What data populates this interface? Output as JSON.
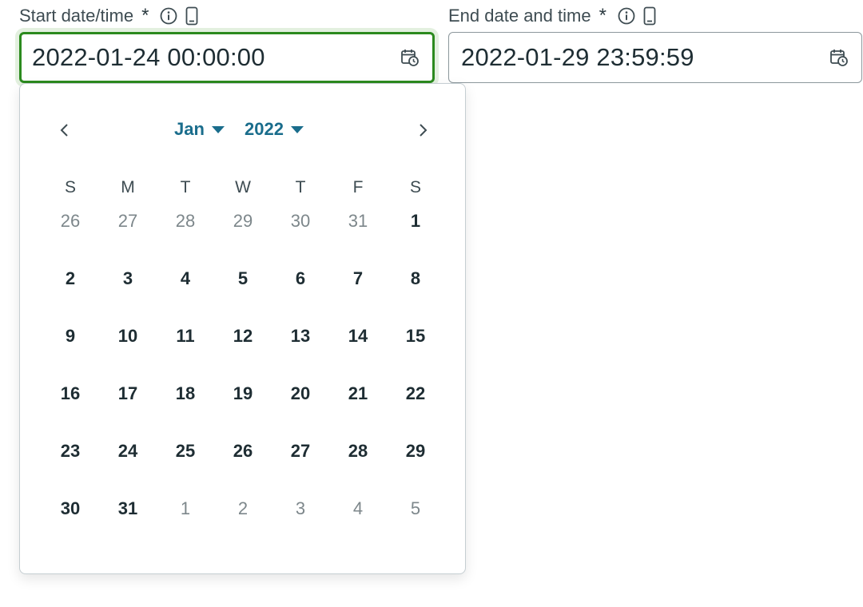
{
  "start_field": {
    "label": "Start date/time",
    "required_mark": "*",
    "value": "2022-01-24 00:00:00",
    "info_icon": "info-icon",
    "device_icon": "mobile-device-icon",
    "calendar_icon": "calendar-clock-icon"
  },
  "end_field": {
    "label": "End date and time",
    "required_mark": "*",
    "value": "2022-01-29 23:59:59",
    "info_icon": "info-icon",
    "device_icon": "mobile-device-icon",
    "calendar_icon": "calendar-clock-icon"
  },
  "calendar": {
    "month": "Jan",
    "year": "2022",
    "prev_icon": "chevron-left-icon",
    "next_icon": "chevron-right-icon",
    "weekdays": [
      "S",
      "M",
      "T",
      "W",
      "T",
      "F",
      "S"
    ],
    "weeks": [
      [
        {
          "d": "26",
          "out": true
        },
        {
          "d": "27",
          "out": true
        },
        {
          "d": "28",
          "out": true
        },
        {
          "d": "29",
          "out": true
        },
        {
          "d": "30",
          "out": true
        },
        {
          "d": "31",
          "out": true
        },
        {
          "d": "1",
          "out": false
        }
      ],
      [
        {
          "d": "2",
          "out": false
        },
        {
          "d": "3",
          "out": false
        },
        {
          "d": "4",
          "out": false
        },
        {
          "d": "5",
          "out": false
        },
        {
          "d": "6",
          "out": false
        },
        {
          "d": "7",
          "out": false
        },
        {
          "d": "8",
          "out": false
        }
      ],
      [
        {
          "d": "9",
          "out": false
        },
        {
          "d": "10",
          "out": false
        },
        {
          "d": "11",
          "out": false
        },
        {
          "d": "12",
          "out": false
        },
        {
          "d": "13",
          "out": false
        },
        {
          "d": "14",
          "out": false
        },
        {
          "d": "15",
          "out": false
        }
      ],
      [
        {
          "d": "16",
          "out": false
        },
        {
          "d": "17",
          "out": false
        },
        {
          "d": "18",
          "out": false
        },
        {
          "d": "19",
          "out": false
        },
        {
          "d": "20",
          "out": false
        },
        {
          "d": "21",
          "out": false
        },
        {
          "d": "22",
          "out": false
        }
      ],
      [
        {
          "d": "23",
          "out": false
        },
        {
          "d": "24",
          "out": false
        },
        {
          "d": "25",
          "out": false
        },
        {
          "d": "26",
          "out": false
        },
        {
          "d": "27",
          "out": false
        },
        {
          "d": "28",
          "out": false
        },
        {
          "d": "29",
          "out": false
        }
      ],
      [
        {
          "d": "30",
          "out": false
        },
        {
          "d": "31",
          "out": false
        },
        {
          "d": "1",
          "out": true
        },
        {
          "d": "2",
          "out": true
        },
        {
          "d": "3",
          "out": true
        },
        {
          "d": "4",
          "out": true
        },
        {
          "d": "5",
          "out": true
        }
      ]
    ]
  },
  "colors": {
    "focus_border": "#2b8a1e",
    "accent": "#1a6d8c",
    "outside_day": "#7d878b"
  }
}
